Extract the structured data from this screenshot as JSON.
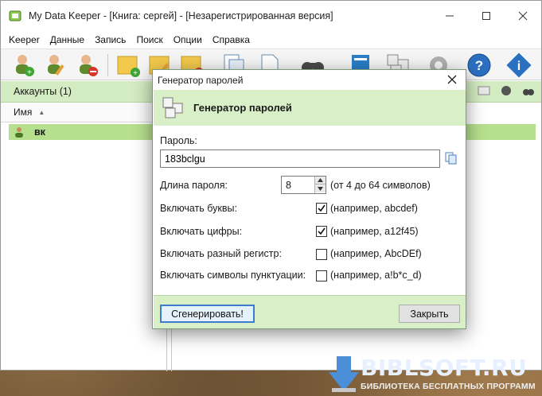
{
  "window": {
    "title": "My Data Keeper - [Книга: сергей] - [Незарегистрированная версия]"
  },
  "menu": [
    "Keeper",
    "Данные",
    "Запись",
    "Поиск",
    "Опции",
    "Справка"
  ],
  "accounts": {
    "header": "Аккаунты (1)",
    "column_name": "Имя",
    "rows": [
      {
        "label": "вк"
      }
    ]
  },
  "dialog": {
    "title": "Генератор паролей",
    "header_title": "Генератор паролей",
    "password_label": "Пароль:",
    "password_value": "183bclgu",
    "length_label": "Длина пароля:",
    "length_value": "8",
    "length_hint": "(от 4 до 64 символов)",
    "options": [
      {
        "label": "Включать буквы:",
        "checked": true,
        "example": "(например, abcdef)"
      },
      {
        "label": "Включать цифры:",
        "checked": true,
        "example": "(например, a12f45)"
      },
      {
        "label": "Включать разный регистр:",
        "checked": false,
        "example": "(например, AbcDEf)"
      },
      {
        "label": "Включать символы пунктуации:",
        "checked": false,
        "example": "(например, a!b*c_d)"
      }
    ],
    "generate_button": "Сгенерировать!",
    "close_button": "Закрыть"
  },
  "watermark": {
    "brand": "BIBLSOFT.RU",
    "tagline": "БИБЛИОТЕКА БЕСПЛАТНЫХ ПРОГРАММ"
  },
  "colors": {
    "accent_green": "#d9efc8",
    "row_selected": "#b7e08e",
    "primary_border": "#3b7bd0"
  }
}
